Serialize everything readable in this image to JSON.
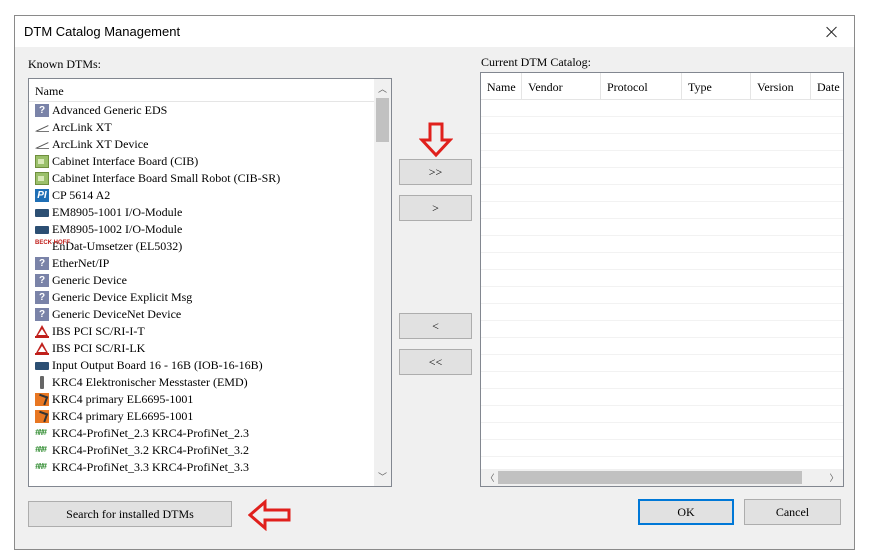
{
  "window": {
    "title": "DTM Catalog Management"
  },
  "known": {
    "label": "Known DTMs:",
    "column": "Name",
    "items": [
      {
        "icon": "generic-device-icon",
        "label": "Advanced Generic EDS"
      },
      {
        "icon": "arclink-icon",
        "label": "ArcLink XT"
      },
      {
        "icon": "arclink-icon",
        "label": "ArcLink XT Device"
      },
      {
        "icon": "board-icon",
        "label": "Cabinet Interface Board (CIB)"
      },
      {
        "icon": "board-icon",
        "label": "Cabinet Interface Board Small Robot (CIB-SR)"
      },
      {
        "icon": "pi-icon",
        "label": "CP 5614 A2"
      },
      {
        "icon": "io-module-icon",
        "label": "EM8905-1001 I/O-Module"
      },
      {
        "icon": "io-module-icon",
        "label": "EM8905-1002 I/O-Module"
      },
      {
        "icon": "beckhoff-icon",
        "label": "EnDat-Umsetzer (EL5032)"
      },
      {
        "icon": "generic-device-icon",
        "label": "EtherNet/IP"
      },
      {
        "icon": "generic-device-icon",
        "label": "Generic Device"
      },
      {
        "icon": "generic-device-icon",
        "label": "Generic Device Explicit Msg"
      },
      {
        "icon": "generic-device-icon",
        "label": "Generic DeviceNet Device"
      },
      {
        "icon": "warning-triangle-icon",
        "label": "IBS PCI SC/RI-I-T"
      },
      {
        "icon": "warning-triangle-icon",
        "label": "IBS PCI SC/RI-LK"
      },
      {
        "icon": "io-module-icon",
        "label": "Input Output Board 16 - 16B (IOB-16-16B)"
      },
      {
        "icon": "probe-icon",
        "label": "KRC4 Elektronischer Messtaster (EMD)"
      },
      {
        "icon": "robot-icon",
        "label": "KRC4 primary EL6695-1001"
      },
      {
        "icon": "robot-icon",
        "label": "KRC4 primary EL6695-1001"
      },
      {
        "icon": "profinet-icon",
        "label": "KRC4-ProfiNet_2.3 KRC4-ProfiNet_2.3"
      },
      {
        "icon": "profinet-icon",
        "label": "KRC4-ProfiNet_3.2 KRC4-ProfiNet_3.2"
      },
      {
        "icon": "profinet-icon",
        "label": "KRC4-ProfiNet_3.3 KRC4-ProfiNet_3.3"
      }
    ]
  },
  "current": {
    "label": "Current DTM Catalog:",
    "columns": [
      "Name",
      "Vendor",
      "Protocol",
      "Type",
      "Version",
      "Date"
    ]
  },
  "buttons": {
    "add_all": ">>",
    "add": ">",
    "remove": "<",
    "remove_all": "<<",
    "search": "Search for installed DTMs",
    "ok": "OK",
    "cancel": "Cancel"
  },
  "colors": {
    "annotation_arrow": "#e0201c",
    "default_button_border": "#0078d7"
  }
}
